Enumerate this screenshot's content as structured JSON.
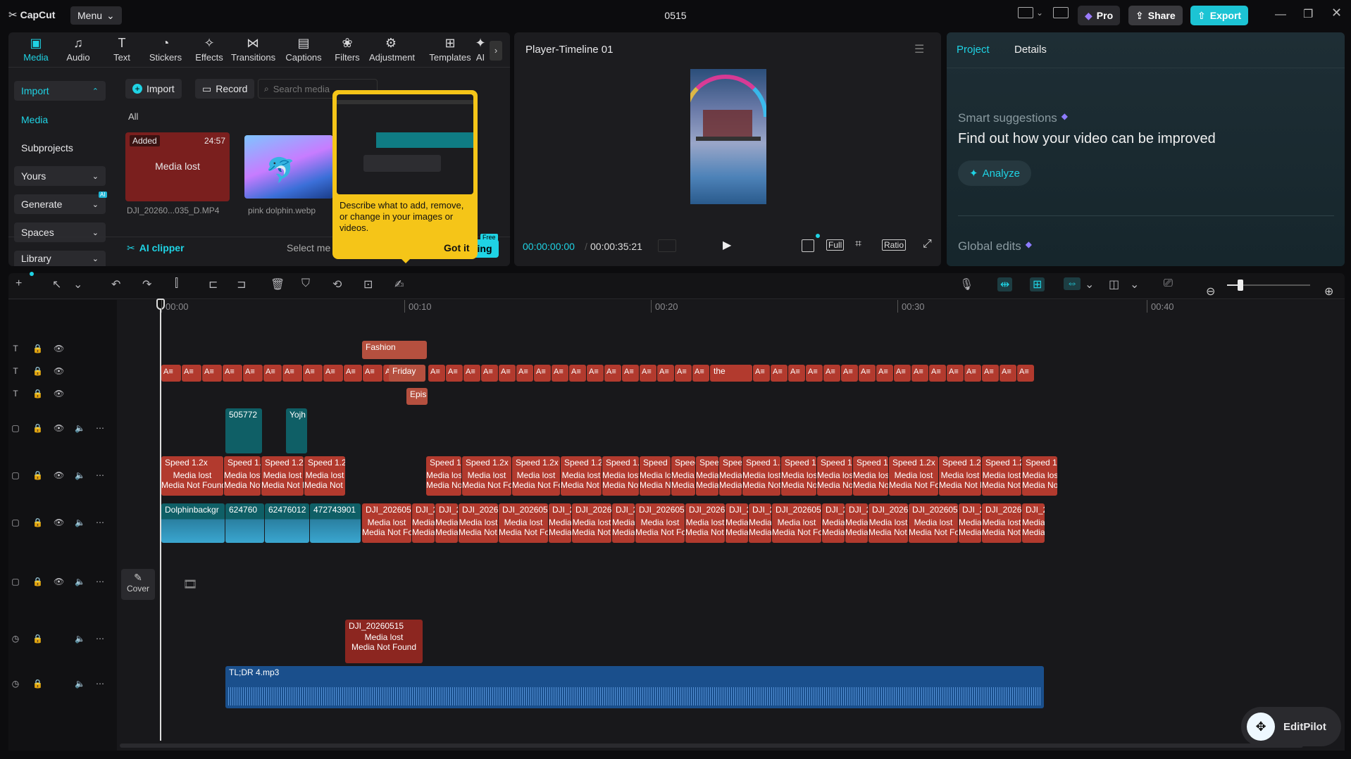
{
  "app": {
    "name": "CapCut",
    "menu_label": "Menu",
    "project_title": "0515",
    "pro_label": "Pro",
    "share_label": "Share",
    "export_label": "Export"
  },
  "toolbar": {
    "items": [
      {
        "label": "Media",
        "icon": "media-icon"
      },
      {
        "label": "Audio",
        "icon": "audio-icon"
      },
      {
        "label": "Text",
        "icon": "text-icon"
      },
      {
        "label": "Stickers",
        "icon": "stickers-icon"
      },
      {
        "label": "Effects",
        "icon": "effects-icon"
      },
      {
        "label": "Transitions",
        "icon": "transitions-icon"
      },
      {
        "label": "Captions",
        "icon": "captions-icon"
      },
      {
        "label": "Filters",
        "icon": "filters-icon"
      },
      {
        "label": "Adjustment",
        "icon": "adjustment-icon"
      },
      {
        "label": "Templates",
        "icon": "templates-icon"
      },
      {
        "label": "AI",
        "icon": "ai-icon"
      }
    ]
  },
  "sidebar": {
    "items": [
      "Import",
      "Media",
      "Subprojects",
      "Yours",
      "Generate",
      "Spaces",
      "Library"
    ],
    "ai_badge": "AI"
  },
  "media": {
    "import_label": "Import",
    "record_label": "Record",
    "search_placeholder": "Search media",
    "filter_all": "All",
    "items": [
      {
        "badge": "Added",
        "duration": "24:57",
        "status": "Media lost",
        "name": "DJI_20260...035_D.MP4"
      },
      {
        "name": "pink dolphin.webp"
      }
    ],
    "ai_clipper": "AI clipper",
    "select_media": "Select me",
    "free_badge": "Free",
    "cut_label": "ing"
  },
  "tooltip": {
    "text": "Describe what to add, remove, or change in your images or videos.",
    "action": "Got it"
  },
  "player": {
    "title": "Player-Timeline 01",
    "current_time": "00:00:00:00",
    "total_time": "00:00:35:21",
    "full_label": "Full",
    "ratio_label": "Ratio"
  },
  "right_panel": {
    "tabs": [
      "Project",
      "Details"
    ],
    "smart_title": "Smart suggestions",
    "smart_heading": "Find out how your video can be improved",
    "analyze_label": "Analyze",
    "global_edits": "Global edits"
  },
  "timeline": {
    "ruler": [
      "00:00",
      "00:10",
      "00:20",
      "00:30",
      "00:40"
    ],
    "cover_label": "Cover",
    "text_clips": {
      "fashion": "Fashion",
      "friday": "Friday",
      "epis": "Epis",
      "the": "the"
    },
    "video_small": [
      "505772",
      "Yojh"
    ],
    "speed_label": "Speed 1.2x",
    "lost_label": "Media lost",
    "not_found": "Media Not Found",
    "main_clips": [
      "Dolphinbackgr",
      "624760",
      "62476012",
      "472743901"
    ],
    "dji_label": "DJI_2026051",
    "audio_label": "TL;DR 4.mp3",
    "overlay_dji": "DJI_20260515"
  },
  "editpilot": {
    "label": "EditPilot"
  },
  "colors": {
    "accent": "#1fd3e4",
    "clip_red": "#b23a2e",
    "tooltip_yellow": "#f5c518",
    "audio_blue": "#1a4f8c"
  }
}
